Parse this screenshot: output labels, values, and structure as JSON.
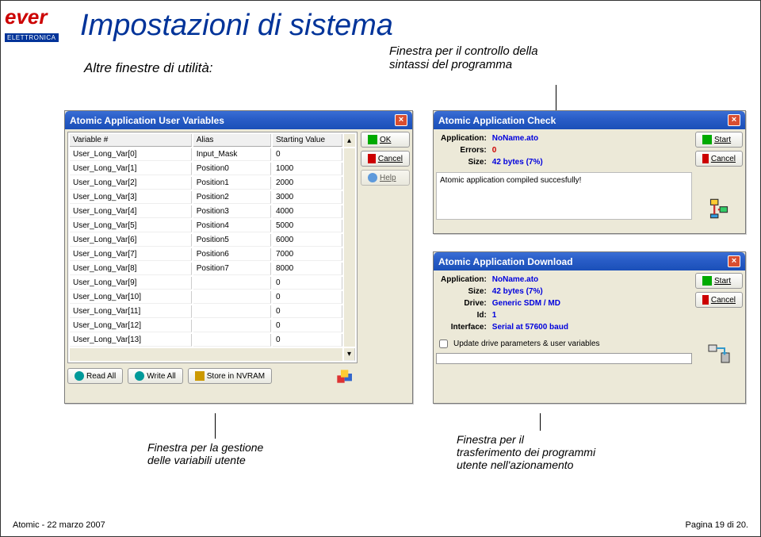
{
  "logo": {
    "brand": "ever",
    "sub": "ELETTRONICA"
  },
  "title": "Impostazioni di sistema",
  "subtitle": "Altre finestre di utilità:",
  "labels": {
    "top": "Finestra per il controllo della\nsintassi del programma",
    "left": "Finestra per la gestione\ndelle variabili utente",
    "right": "Finestra per il\ntrasferimento dei programmi\nutente nell'azionamento"
  },
  "footer": {
    "left": "Atomic  -  22 marzo 2007",
    "right": "Pagina 19 di 20."
  },
  "win1": {
    "title": "Atomic Application User Variables",
    "cols": {
      "c1": "Variable #",
      "c2": "Alias",
      "c3": "Starting Value"
    },
    "rows": [
      {
        "v": "User_Long_Var[0]",
        "a": "Input_Mask",
        "s": "0"
      },
      {
        "v": "User_Long_Var[1]",
        "a": "Position0",
        "s": "1000"
      },
      {
        "v": "User_Long_Var[2]",
        "a": "Position1",
        "s": "2000"
      },
      {
        "v": "User_Long_Var[3]",
        "a": "Position2",
        "s": "3000"
      },
      {
        "v": "User_Long_Var[4]",
        "a": "Position3",
        "s": "4000"
      },
      {
        "v": "User_Long_Var[5]",
        "a": "Position4",
        "s": "5000"
      },
      {
        "v": "User_Long_Var[6]",
        "a": "Position5",
        "s": "6000"
      },
      {
        "v": "User_Long_Var[7]",
        "a": "Position6",
        "s": "7000"
      },
      {
        "v": "User_Long_Var[8]",
        "a": "Position7",
        "s": "8000"
      },
      {
        "v": "User_Long_Var[9]",
        "a": "",
        "s": "0"
      },
      {
        "v": "User_Long_Var[10]",
        "a": "",
        "s": "0"
      },
      {
        "v": "User_Long_Var[11]",
        "a": "",
        "s": "0"
      },
      {
        "v": "User_Long_Var[12]",
        "a": "",
        "s": "0"
      },
      {
        "v": "User_Long_Var[13]",
        "a": "",
        "s": "0"
      }
    ],
    "btns": {
      "ok": "OK",
      "cancel": "Cancel",
      "help": "Help",
      "readall": "Read All",
      "writeall": "Write All",
      "store": "Store in NVRAM"
    }
  },
  "win2": {
    "title": "Atomic Application Check",
    "fields": {
      "app_l": "Application:",
      "app_v": "NoName.ato",
      "err_l": "Errors:",
      "err_v": "0",
      "size_l": "Size:",
      "size_v": "42 bytes (7%)"
    },
    "msg": "Atomic application compiled succesfully!",
    "btns": {
      "start": "Start",
      "cancel": "Cancel"
    }
  },
  "win3": {
    "title": "Atomic Application Download",
    "fields": {
      "app_l": "Application:",
      "app_v": "NoName.ato",
      "size_l": "Size:",
      "size_v": "42 bytes (7%)",
      "drive_l": "Drive:",
      "drive_v": "Generic SDM / MD",
      "id_l": "Id:",
      "id_v": "1",
      "if_l": "Interface:",
      "if_v": "Serial at 57600 baud"
    },
    "check": "Update drive parameters & user variables",
    "btns": {
      "start": "Start",
      "cancel": "Cancel"
    }
  }
}
